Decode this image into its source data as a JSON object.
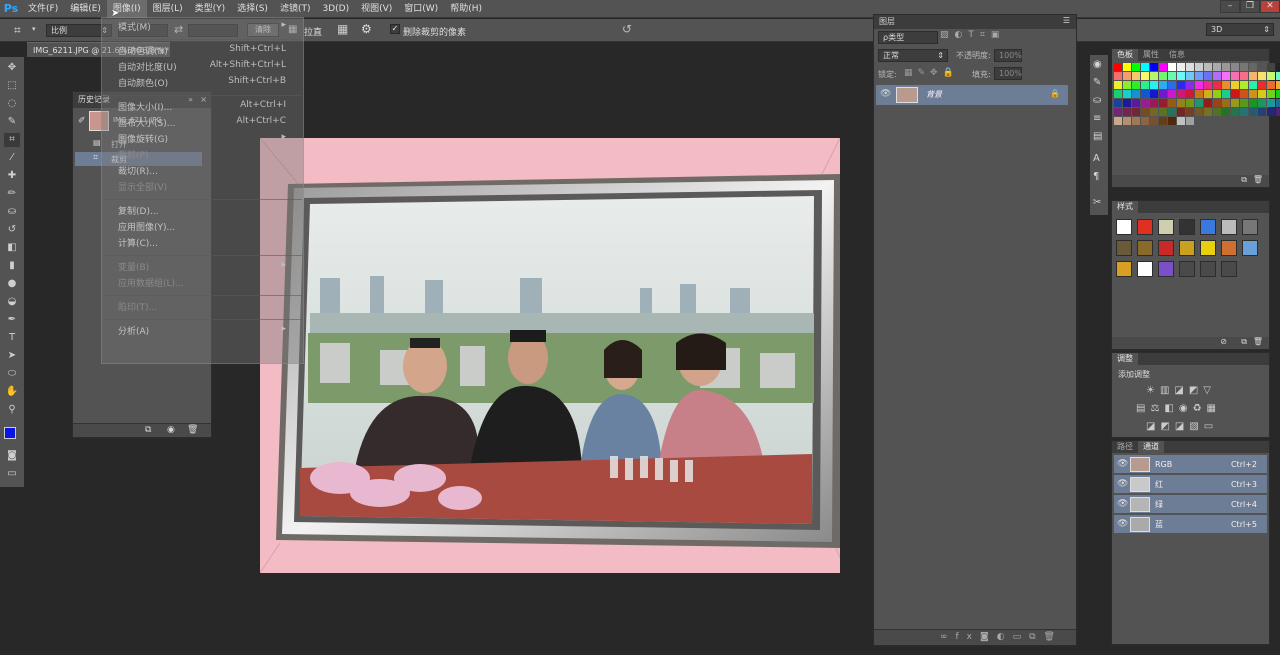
{
  "menubar": {
    "logo": "Ps",
    "items": [
      "文件(F)",
      "编辑(E)",
      "图像(I)",
      "图层(L)",
      "类型(Y)",
      "选择(S)",
      "滤镜(T)",
      "3D(D)",
      "视图(V)",
      "窗口(W)",
      "帮助(H)"
    ],
    "active_index": 2
  },
  "options": {
    "ratio_select": "比例",
    "clear_button": "清除",
    "straighten_label": "拉直",
    "delete_cropped_label": "删除裁剪的像素",
    "workspace_select": "3D"
  },
  "document": {
    "tab_title": "IMG_6211.JPG @ 21.6%(RGB/8*) *",
    "tab_close": "×"
  },
  "history": {
    "title": "历史记录",
    "snapshot_name": "IMG_6211.JPG",
    "steps": [
      "打开",
      "裁剪"
    ],
    "selected_step": 1
  },
  "image_menu": {
    "items": [
      {
        "label": "模式(M)",
        "shortcut": "",
        "submenu": true,
        "dim": false
      },
      {
        "sep": true
      },
      {
        "label": "自动色调(N)",
        "shortcut": "Shift+Ctrl+L",
        "dim": false
      },
      {
        "label": "自动对比度(U)",
        "shortcut": "Alt+Shift+Ctrl+L",
        "dim": false
      },
      {
        "label": "自动颜色(O)",
        "shortcut": "Shift+Ctrl+B",
        "dim": false
      },
      {
        "sep": true
      },
      {
        "label": "图像大小(I)...",
        "shortcut": "Alt+Ctrl+I",
        "dim": false
      },
      {
        "label": "画布大小(S)...",
        "shortcut": "Alt+Ctrl+C",
        "dim": false
      },
      {
        "label": "图像旋转(G)",
        "shortcut": "",
        "submenu": true,
        "dim": false
      },
      {
        "label": "裁剪(P)",
        "shortcut": "",
        "dim": true
      },
      {
        "label": "裁切(R)...",
        "shortcut": "",
        "dim": false
      },
      {
        "label": "显示全部(V)",
        "shortcut": "",
        "dim": true
      },
      {
        "sep": true
      },
      {
        "label": "复制(D)...",
        "shortcut": "",
        "dim": false
      },
      {
        "label": "应用图像(Y)...",
        "shortcut": "",
        "dim": false
      },
      {
        "label": "计算(C)...",
        "shortcut": "",
        "dim": false
      },
      {
        "sep": true
      },
      {
        "label": "变量(B)",
        "shortcut": "",
        "submenu": true,
        "dim": true
      },
      {
        "label": "应用数据组(L)...",
        "shortcut": "",
        "dim": true
      },
      {
        "sep": true
      },
      {
        "label": "陷印(T)...",
        "shortcut": "",
        "dim": true
      },
      {
        "sep": true
      },
      {
        "label": "分析(A)",
        "shortcut": "",
        "submenu": true,
        "dim": false
      }
    ]
  },
  "layers": {
    "title": "图层",
    "filter_kind": "ρ类型",
    "blend_mode": "正常",
    "opacity_label": "不透明度:",
    "opacity_value": "100%",
    "lock_label": "锁定:",
    "fill_label": "填充:",
    "fill_value": "100%",
    "layer_name": "背景"
  },
  "swatches": {
    "tabs": [
      "色板",
      "属性",
      "信息"
    ]
  },
  "styles": {
    "title": "样式"
  },
  "adjustments": {
    "title": "调整",
    "add_label": "添加调整"
  },
  "channels": {
    "tabs": [
      "路径",
      "通道"
    ],
    "rows": [
      {
        "name": "RGB",
        "shortcut": "Ctrl+2"
      },
      {
        "name": "红",
        "shortcut": "Ctrl+3"
      },
      {
        "name": "绿",
        "shortcut": "Ctrl+4"
      },
      {
        "name": "蓝",
        "shortcut": "Ctrl+5"
      }
    ]
  },
  "colors": {
    "foreground": "#0a14e6",
    "background": "#ffffff",
    "selection": "#6e7d96",
    "canvas_pink": "#f3bcc4"
  }
}
